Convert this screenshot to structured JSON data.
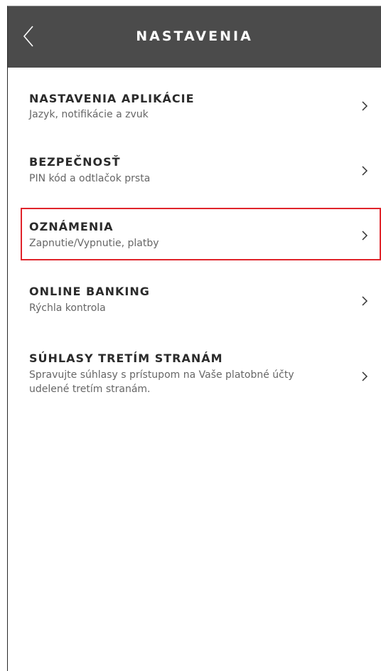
{
  "header": {
    "title": "NASTAVENIA",
    "back_icon": "chevron-left-icon"
  },
  "settings": {
    "items": [
      {
        "title": "NASTAVENIA APLIKÁCIE",
        "subtitle": "Jazyk, notifikácie a zvuk"
      },
      {
        "title": "BEZPEČNOSŤ",
        "subtitle": "PIN kód a odtlačok prsta"
      },
      {
        "title": "OZNÁMENIA",
        "subtitle": "Zapnutie/Vypnutie, platby"
      },
      {
        "title": "ONLINE BANKING",
        "subtitle": "Rýchla kontrola"
      },
      {
        "title": "SÚHLASY TRETÍM STRANÁM",
        "subtitle": "Spravujte súhlasy s prístupom na Vaše platobné účty",
        "subtitle_line2": "udelené tretím stranám."
      }
    ]
  },
  "colors": {
    "header_bg": "#4b4b4b",
    "highlight": "#e0242b"
  }
}
